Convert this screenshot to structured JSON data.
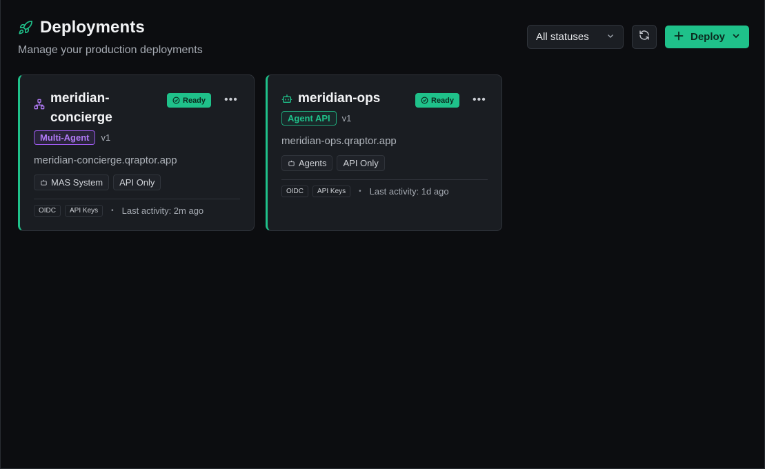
{
  "header": {
    "title": "Deployments",
    "subtitle": "Manage your production deployments",
    "icon": "rocket-icon"
  },
  "toolbar": {
    "status_filter": "All statuses",
    "refresh_icon": "refresh-icon",
    "deploy_label": "Deploy"
  },
  "colors": {
    "accent": "#1fc18a",
    "purple": "#9e5cf0",
    "background": "#0c0d10",
    "card": "#1a1d22"
  },
  "cards": [
    {
      "name": "meridian-concierge",
      "icon": "network-icon",
      "status": "Ready",
      "type": "Multi-Agent",
      "version": "v1",
      "url": "meridian-concierge.qraptor.app",
      "chips": [
        "MAS System",
        "API Only"
      ],
      "auth": [
        "OIDC",
        "API Keys"
      ],
      "activity": "Last activity: 2m ago"
    },
    {
      "name": "meridian-ops",
      "icon": "bot-icon",
      "status": "Ready",
      "type": "Agent API",
      "version": "v1",
      "url": "meridian-ops.qraptor.app",
      "chips": [
        "Agents",
        "API Only"
      ],
      "auth": [
        "OIDC",
        "API Keys"
      ],
      "activity": "Last activity: 1d ago"
    }
  ]
}
